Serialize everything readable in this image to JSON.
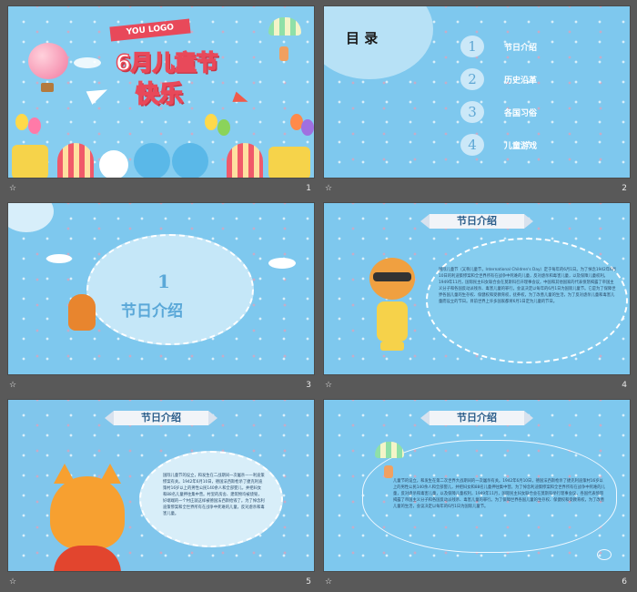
{
  "slides": [
    {
      "num": "1",
      "logo": "YOU LOGO",
      "title_line1": "6月儿童节",
      "title_line2": "快乐"
    },
    {
      "num": "2",
      "heading": "目 录",
      "items": [
        {
          "n": "1",
          "label": "节日介绍"
        },
        {
          "n": "2",
          "label": "历史沿革"
        },
        {
          "n": "3",
          "label": "各国习俗"
        },
        {
          "n": "4",
          "label": "儿童游戏"
        }
      ]
    },
    {
      "num": "3",
      "section_num": "1",
      "section_title": "节日介绍"
    },
    {
      "num": "4",
      "ribbon": "节日介绍",
      "text": "国际儿童节（又称儿童节，International Children's Day）定于每年的6月1日。为了悼念1942年6月10日的利迪策惨案和全世界所有在战争中死难的儿童，反对虐杀和毒害儿童，以及保障儿童权利。1949年11月，国际民主妇女联合会在莫斯科召开理事会议，中国和其他国家的代表愤怒揭露了帝国主义分子和各国反动派残杀、毒害儿童的罪行。会议决定以每年的6月1日为国际儿童节。它是为了保障世界各国儿童的生存权、保健权和受教育权，抚养权，为了改善儿童的生活，为了反对虐杀儿童和毒害儿童而设立的节日。目前世界上许多国家都将6月1日定为儿童的节日。"
    },
    {
      "num": "5",
      "ribbon": "节日介绍",
      "text": "国际儿童节的设立，和发生在二战期间一次屠杀——利迪策惨案有关。1942年6月10日，德国法西斯枪杀了捷克利迪策村16岁以上的男性公民140余人和全部婴儿，并把妇女和88名儿童押往集中营。村里的房舍、建筑物均被烧毁，好端端的一个村庄就这样被德国法西斯给毁了。为了悼念利迪策惨案和全世界所有在战争中死难的儿童，反对虐杀和毒害儿童。"
    },
    {
      "num": "6",
      "ribbon": "节日介绍",
      "text": "儿童节的设立，和发生在第二次世界大战期间的一次屠杀有关。1942年6月10日，德国法西斯枪杀了捷克利迪策村16岁以上的男性公民140余人和全部婴儿，并把妇女和88名儿童押往集中营。为了悼念利迪策惨案和全世界所有在战争中死难的儿童，反对虐杀和毒害儿童，以及保障儿童权利，1949年11月，国际民主妇女联合会在莫斯科举行理事会议，各国代表愤怒揭露了帝国主义分子和各国反动派残杀、毒害儿童的罪行。为了保障世界各国儿童的生存权、保健权和受教育权，为了改善儿童的生活，会议决定以每年的6月1日为国际儿童节。"
    }
  ],
  "star": "☆"
}
